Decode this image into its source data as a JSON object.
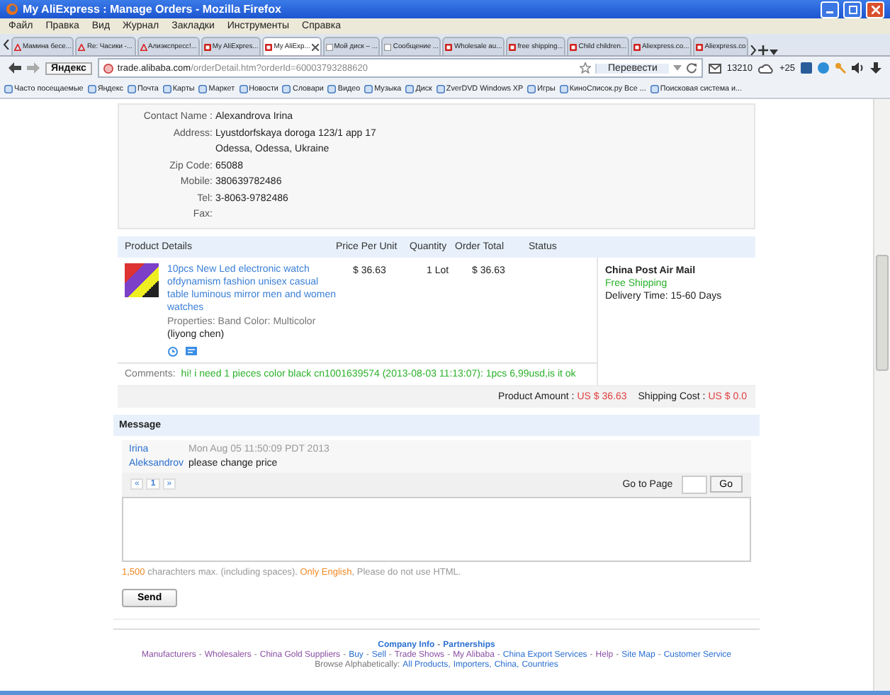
{
  "window": {
    "title": "My AliExpress : Manage Orders - Mozilla Firefox"
  },
  "menu": [
    "Файл",
    "Правка",
    "Вид",
    "Журнал",
    "Закладки",
    "Инструменты",
    "Справка"
  ],
  "tabs": [
    {
      "label": "Мамина бесе...",
      "kind": "triangle",
      "selected": false
    },
    {
      "label": "Re: Часики -...",
      "kind": "triangle",
      "selected": false
    },
    {
      "label": "Алиэкспресс!...",
      "kind": "triangle",
      "selected": false
    },
    {
      "label": "My AliExpres...",
      "kind": "square",
      "selected": false
    },
    {
      "label": "My AliExp...",
      "kind": "square",
      "selected": true
    },
    {
      "label": "Мой диск – ...",
      "kind": "blank",
      "selected": false
    },
    {
      "label": "Сообщение ...",
      "kind": "blank",
      "selected": false
    },
    {
      "label": "Wholesale au...",
      "kind": "square",
      "selected": false
    },
    {
      "label": "free shipping...",
      "kind": "square",
      "selected": false
    },
    {
      "label": "Child children...",
      "kind": "square",
      "selected": false
    },
    {
      "label": "Aliexpress.co...",
      "kind": "square",
      "selected": false
    },
    {
      "label": "Aliexpress.co",
      "kind": "square",
      "selected": false
    }
  ],
  "navbar": {
    "logo": "Яндекс",
    "url_host": "trade.alibaba.com",
    "url_path": "/orderDetail.htm?orderId=60003793288620",
    "translate": "Перевести",
    "mail_count": "13210",
    "weather": "+25"
  },
  "bookmarks": [
    "Часто посещаемые",
    "Яндекс",
    "Почта",
    "Карты",
    "Маркет",
    "Новости",
    "Словари",
    "Видео",
    "Музыка",
    "Диск",
    "ZverDVD Windows XP",
    "Игры",
    "КиноСписок.ру Все ...",
    "Поисковая система и..."
  ],
  "contact": [
    {
      "label": "Contact Name :",
      "value": "Alexandrova Irina"
    },
    {
      "label": "Address:",
      "value": "Lyustdorfskaya doroga 123/1 app 17"
    },
    {
      "value": "Odessa, Odessa, Ukraine"
    },
    {
      "label": "Zip Code:",
      "value": "65088"
    },
    {
      "label": "Mobile:",
      "value": "380639782486"
    },
    {
      "label": "Tel:",
      "value": "3-8063-9782486"
    },
    {
      "label": "Fax:"
    }
  ],
  "order_table": {
    "columns": [
      "Product Details",
      "Price Per Unit",
      "Quantity",
      "Order Total",
      "Status"
    ],
    "product": {
      "title": "10pcs New Led electronic watch ofdynamism fashion unisex casual table luminous mirror men and women watches",
      "properties": "Properties: Band Color: Multicolor",
      "seller": "(liyong chen)",
      "price": "$ 36.63",
      "quantity": "1 Lot",
      "total": "$ 36.63"
    },
    "shipping": {
      "method": "China Post Air Mail",
      "cost_label": "Free Shipping",
      "delivery": "Delivery Time:  15-60 Days"
    },
    "comments_label": "Comments:",
    "comments": "hi! i need 1 pieces color black cn1001639574 (2013-08-03 11:13:07): 1pcs 6,99usd,is it ok",
    "product_amount_label": "Product Amount :",
    "product_amount": "US $ 36.63",
    "shipping_cost_label": "Shipping Cost :",
    "shipping_cost": "US $ 0.0"
  },
  "message": {
    "title": "Message",
    "author_first": "Irina",
    "author_last": "Aleksandrov",
    "time": "Mon Aug 05 11:50:09 PDT 2013",
    "text": "please change price",
    "pages": [
      {
        "label": "«",
        "selected": false
      },
      {
        "label": "1",
        "selected": true
      },
      {
        "label": "»",
        "selected": false
      }
    ],
    "goto_label": "Go to Page",
    "go": "Go",
    "note": [
      {
        "text": "1,500",
        "highlight": true
      },
      {
        "text": " charachters max. (including spaces). ",
        "highlight": false
      },
      {
        "text": "Only English",
        "highlight": true
      },
      {
        "text": ", Please do not use HTML.",
        "highlight": false
      }
    ],
    "send": "Send"
  },
  "footer": {
    "top": [
      "Company Info",
      "Partnerships"
    ],
    "separator": "-",
    "links": [
      {
        "label": "Manufacturers",
        "visited": true
      },
      {
        "label": "Wholesalers",
        "visited": true
      },
      {
        "label": "China Gold Suppliers",
        "visited": true
      },
      {
        "label": "Buy",
        "visited": false
      },
      {
        "label": "Sell",
        "visited": false
      },
      {
        "label": "Trade Shows",
        "visited": true
      },
      {
        "label": "My Alibaba",
        "visited": true
      },
      {
        "label": "China Export Services",
        "visited": false
      },
      {
        "label": "Help",
        "visited": true
      },
      {
        "label": "Site Map",
        "visited": false
      },
      {
        "label": "Customer Service",
        "visited": false
      }
    ],
    "browse_label": "Browse Alphabetically:",
    "browse": [
      "All Products",
      "Importers",
      "China",
      "Countries"
    ],
    "browse_separator": ","
  }
}
